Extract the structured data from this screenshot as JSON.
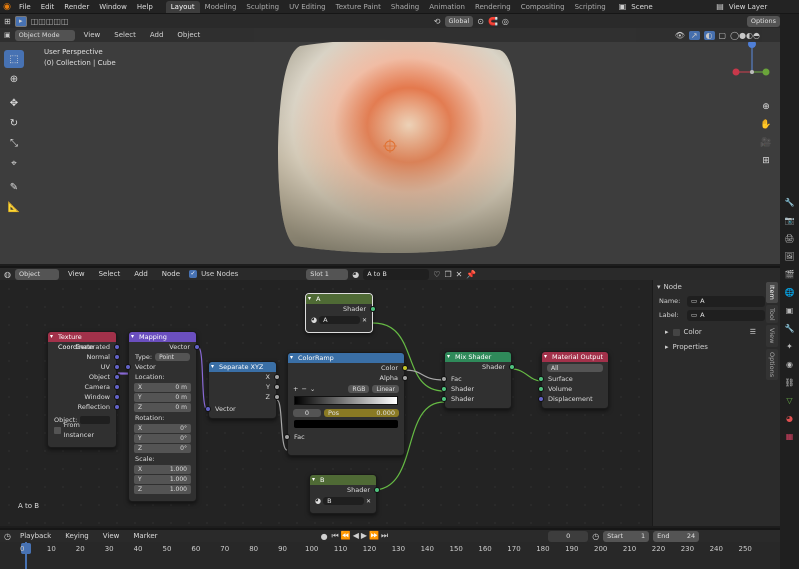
{
  "menu": [
    "File",
    "Edit",
    "Render",
    "Window",
    "Help"
  ],
  "workspaces": [
    "Layout",
    "Modeling",
    "Sculpting",
    "UV Editing",
    "Texture Paint",
    "Shading",
    "Animation",
    "Rendering",
    "Compositing",
    "Scripting"
  ],
  "active_workspace": "Layout",
  "scene": "Scene",
  "view_layer": "View Layer",
  "viewport": {
    "mode": "Object Mode",
    "menus": [
      "View",
      "Select",
      "Add",
      "Object"
    ],
    "transform_orientation": "Global",
    "options": "Options",
    "perspective": "User Perspective",
    "collection": "(0) Collection | Cube"
  },
  "node_editor": {
    "type": "Object",
    "menus": [
      "View",
      "Select",
      "Add",
      "Node"
    ],
    "use_nodes": "Use Nodes",
    "slot": "Slot 1",
    "material": "A to B",
    "footer_label": "A to B"
  },
  "nodes": {
    "tex_coord": {
      "title": "Texture Coordinate",
      "outputs": [
        "Generated",
        "Normal",
        "UV",
        "Object",
        "Camera",
        "Window",
        "Reflection"
      ],
      "object_label": "Object:",
      "from_instancer": "From Instancer"
    },
    "mapping": {
      "title": "Mapping",
      "out": "Vector",
      "type_label": "Type:",
      "type_value": "Point",
      "vector": "Vector",
      "location": "Location:",
      "rotation": "Rotation:",
      "scale": "Scale:",
      "loc": [
        [
          "X",
          "0 m"
        ],
        [
          "Y",
          "0 m"
        ],
        [
          "Z",
          "0 m"
        ]
      ],
      "rot": [
        [
          "X",
          "0°"
        ],
        [
          "Y",
          "0°"
        ],
        [
          "Z",
          "0°"
        ]
      ],
      "scl": [
        [
          "X",
          "1.000"
        ],
        [
          "Y",
          "1.000"
        ],
        [
          "Z",
          "1.000"
        ]
      ]
    },
    "sep_xyz": {
      "title": "Separate XYZ",
      "outs": [
        "X",
        "Y",
        "Z"
      ],
      "in": "Vector"
    },
    "ramp": {
      "title": "ColorRamp",
      "outs": [
        "Color",
        "Alpha"
      ],
      "mode": "RGB",
      "interp": "Linear",
      "index": "0",
      "pos_label": "Pos",
      "pos_value": "0.000",
      "in": "Fac"
    },
    "imgA": {
      "title": "A",
      "out": "Shader",
      "image": "A"
    },
    "imgB": {
      "title": "B",
      "out": "Shader",
      "image": "B"
    },
    "mix": {
      "title": "Mix Shader",
      "out": "Shader",
      "ins": [
        "Fac",
        "Shader",
        "Shader"
      ]
    },
    "matout": {
      "title": "Material Output",
      "target": "All",
      "ins": [
        "Surface",
        "Volume",
        "Displacement"
      ]
    }
  },
  "npanel": {
    "section": "Node",
    "name_label": "Name:",
    "name_value": "A",
    "label_label": "Label:",
    "label_value": "A",
    "color": "Color",
    "properties": "Properties",
    "tabs": [
      "Item",
      "Tool",
      "View",
      "Options"
    ]
  },
  "timeline": {
    "menus": [
      "Playback",
      "Keying",
      "View",
      "Marker"
    ],
    "current": "0",
    "start_label": "Start",
    "start": "1",
    "end_label": "End",
    "end": "24",
    "ticks": [
      "0",
      "10",
      "20",
      "30",
      "40",
      "50",
      "60",
      "70",
      "80",
      "90",
      "100",
      "110",
      "120",
      "130",
      "140",
      "150",
      "160",
      "170",
      "180",
      "190",
      "200",
      "210",
      "220",
      "230",
      "240",
      "250"
    ]
  }
}
